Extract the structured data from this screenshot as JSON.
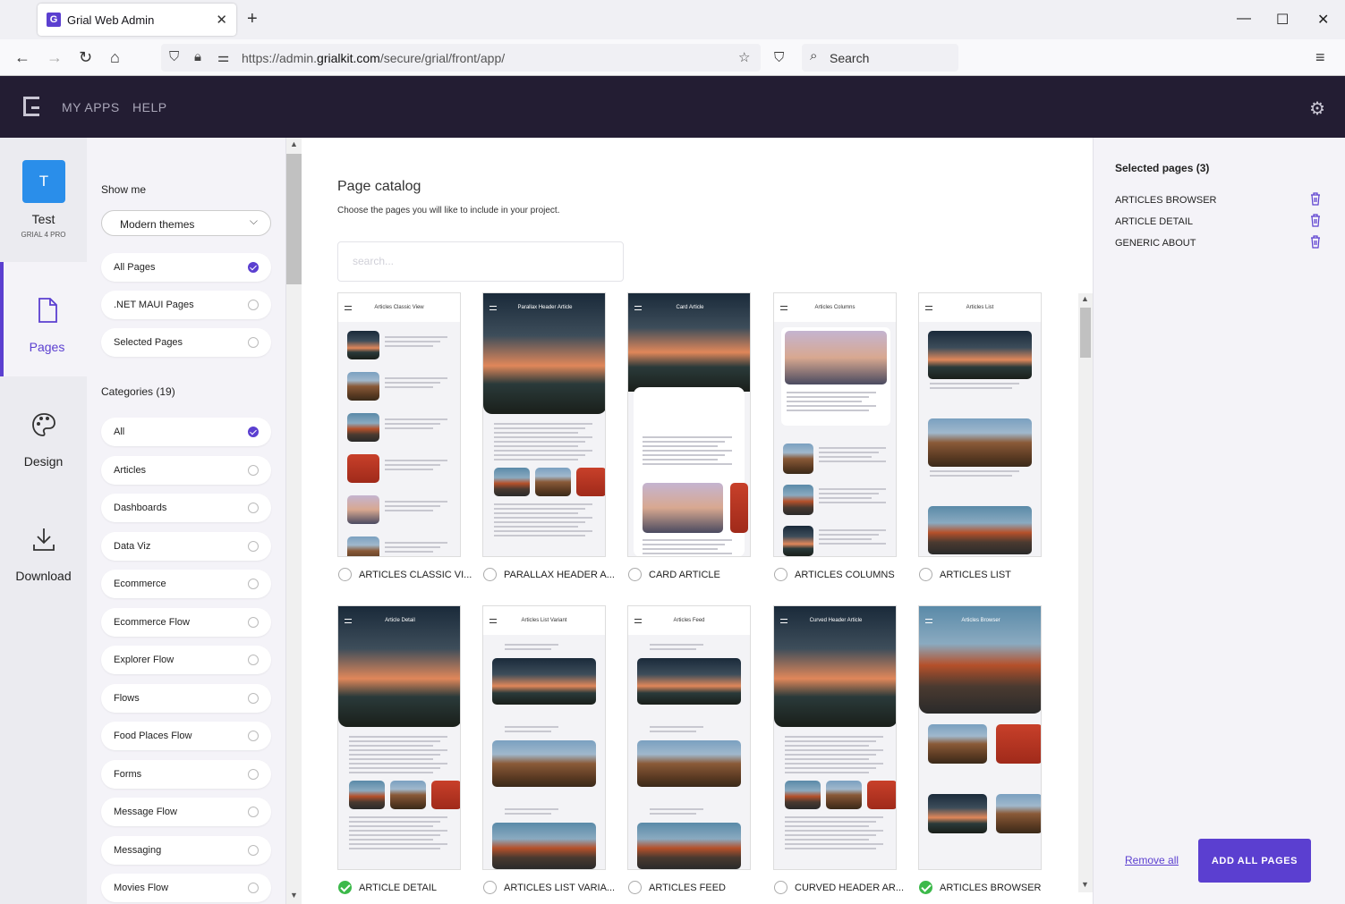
{
  "browser": {
    "tab_title": "Grial Web Admin",
    "favicon": "G",
    "url_prefix": "https://admin.",
    "url_domain": "grialkit.com",
    "url_path": "/secure/grial/front/app/",
    "search_placeholder": "Search"
  },
  "app": {
    "nav": [
      "MY APPS",
      "HELP"
    ]
  },
  "project": {
    "initial": "T",
    "name": "Test",
    "edition": "GRIAL 4 PRO"
  },
  "rail": {
    "items": [
      {
        "label": "Pages",
        "icon": "file-icon",
        "active": true
      },
      {
        "label": "Design",
        "icon": "palette-icon",
        "active": false
      },
      {
        "label": "Download",
        "icon": "download-icon",
        "active": false
      }
    ]
  },
  "filters": {
    "show_me_label": "Show me",
    "theme_selected": "Modern themes",
    "view_options": [
      {
        "label": "All Pages",
        "selected": true
      },
      {
        "label": ".NET MAUI Pages",
        "selected": false
      },
      {
        "label": "Selected Pages",
        "selected": false
      }
    ],
    "categories_label": "Categories (19)",
    "categories": [
      {
        "label": "All",
        "selected": true
      },
      {
        "label": "Articles",
        "selected": false
      },
      {
        "label": "Dashboards",
        "selected": false
      },
      {
        "label": "Data Viz",
        "selected": false
      },
      {
        "label": "Ecommerce",
        "selected": false
      },
      {
        "label": "Ecommerce Flow",
        "selected": false
      },
      {
        "label": "Explorer Flow",
        "selected": false
      },
      {
        "label": "Flows",
        "selected": false
      },
      {
        "label": "Food Places Flow",
        "selected": false
      },
      {
        "label": "Forms",
        "selected": false
      },
      {
        "label": "Message Flow",
        "selected": false
      },
      {
        "label": "Messaging",
        "selected": false
      },
      {
        "label": "Movies Flow",
        "selected": false
      }
    ]
  },
  "catalog": {
    "title": "Page catalog",
    "subtitle": "Choose the pages you will like to include in your project.",
    "search_placeholder": "search...",
    "pages": [
      {
        "label": "ARTICLES CLASSIC VI...",
        "screen_title": "Articles Classic View",
        "selected": false,
        "style": "list"
      },
      {
        "label": "PARALLAX HEADER A...",
        "screen_title": "Parallax Header Article",
        "selected": false,
        "style": "header"
      },
      {
        "label": "CARD ARTICLE",
        "screen_title": "Card Article",
        "selected": false,
        "style": "card"
      },
      {
        "label": "ARTICLES COLUMNS",
        "screen_title": "Articles Columns",
        "selected": false,
        "style": "columns"
      },
      {
        "label": "ARTICLES LIST",
        "screen_title": "Articles List",
        "selected": false,
        "style": "biglist"
      },
      {
        "label": "ARTICLE DETAIL",
        "screen_title": "Article Detail",
        "selected": true,
        "style": "header"
      },
      {
        "label": "ARTICLES LIST VARIA...",
        "screen_title": "Articles List Variant",
        "selected": false,
        "style": "feed"
      },
      {
        "label": "ARTICLES FEED",
        "screen_title": "Articles Feed",
        "selected": false,
        "style": "feed"
      },
      {
        "label": "CURVED HEADER AR...",
        "screen_title": "Curved Header Article",
        "selected": false,
        "style": "header"
      },
      {
        "label": "ARTICLES BROWSER",
        "screen_title": "Articles Browser",
        "selected": true,
        "style": "browser"
      }
    ]
  },
  "selection": {
    "header": "Selected pages (3)",
    "items": [
      "ARTICLES BROWSER",
      "ARTICLE DETAIL",
      "GENERIC ABOUT"
    ],
    "remove_all": "Remove all",
    "add_all": "ADD ALL PAGES"
  },
  "colors": {
    "accent": "#5b3fd0",
    "header_bg": "#231d33",
    "selected_check": "#3cb94a"
  }
}
